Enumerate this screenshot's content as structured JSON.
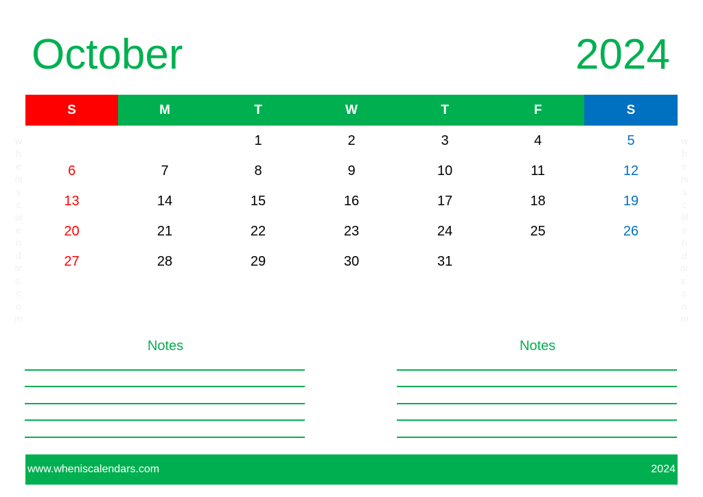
{
  "header": {
    "month": "October",
    "year": "2024"
  },
  "colors": {
    "accent_green": "#00b050",
    "sunday_red": "#ff0000",
    "saturday_blue": "#0070c0",
    "weekday_text": "#000000"
  },
  "weekdays": [
    {
      "label": "S",
      "type": "sunday"
    },
    {
      "label": "M",
      "type": "weekday"
    },
    {
      "label": "T",
      "type": "weekday"
    },
    {
      "label": "W",
      "type": "weekday"
    },
    {
      "label": "T",
      "type": "weekday"
    },
    {
      "label": "F",
      "type": "weekday"
    },
    {
      "label": "S",
      "type": "saturday"
    }
  ],
  "weeks": [
    [
      "",
      "",
      "1",
      "2",
      "3",
      "4",
      "5"
    ],
    [
      "6",
      "7",
      "8",
      "9",
      "10",
      "11",
      "12"
    ],
    [
      "13",
      "14",
      "15",
      "16",
      "17",
      "18",
      "19"
    ],
    [
      "20",
      "21",
      "22",
      "23",
      "24",
      "25",
      "26"
    ],
    [
      "27",
      "28",
      "29",
      "30",
      "31",
      "",
      ""
    ]
  ],
  "watermark": [
    "w",
    "h",
    "e",
    "ni",
    "s",
    "c",
    "al",
    "e",
    "n",
    "d",
    "ar",
    "s.",
    "c",
    "o",
    "m"
  ],
  "notes": [
    {
      "title": "Notes",
      "line_count": 5
    },
    {
      "title": "Notes",
      "line_count": 5
    }
  ],
  "footer": {
    "url": "www.wheniscalendars.com",
    "year": "2024"
  }
}
